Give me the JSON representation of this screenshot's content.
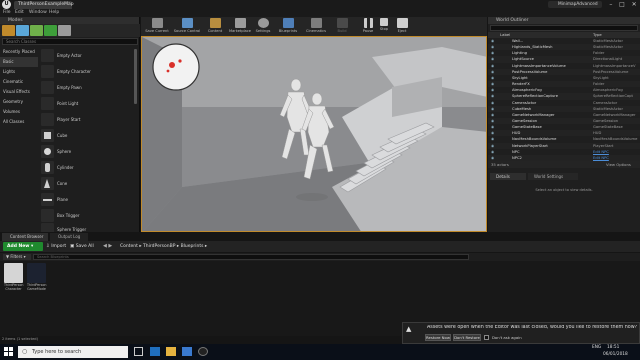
{
  "title_bar": {
    "doc_tab": "ThirdPersonExampleMap",
    "minimap_label": "MinimapAdvanced"
  },
  "menu": [
    "File",
    "Edit",
    "Window",
    "Help"
  ],
  "modes": {
    "header": "Modes",
    "search_placeholder": "Search Classes",
    "categories": [
      "Recently Placed",
      "Basic",
      "Lights",
      "Cinematic",
      "Visual Effects",
      "Geometry",
      "Volumes",
      "All Classes"
    ],
    "selected_category": "Basic",
    "items": [
      "Empty Actor",
      "Empty Character",
      "Empty Pawn",
      "Point Light",
      "Player Start",
      "Cube",
      "Sphere",
      "Cylinder",
      "Cone",
      "Plane",
      "Box Trigger",
      "Sphere Trigger"
    ]
  },
  "toolbar": {
    "buttons": [
      "Save Current",
      "Source Control",
      "Content",
      "Marketplace",
      "Settings",
      "Blueprints",
      "Cinematics",
      "Build",
      "Pause",
      "Stop",
      "Eject"
    ]
  },
  "world_outliner": {
    "header": "World Outliner",
    "col_label": "Label",
    "col_type": "Type",
    "rows": [
      {
        "name": "Wall...",
        "type": "StaticMeshActor"
      },
      {
        "name": "Highlands_StaticMesh",
        "type": "StaticMeshActor"
      },
      {
        "name": "Lighting",
        "type": "Folder"
      },
      {
        "name": "LightSource",
        "type": "DirectionalLight"
      },
      {
        "name": "LightmassImportanceVolume",
        "type": "LightmassImportanceV"
      },
      {
        "name": "PostProcessVolume",
        "type": "PostProcessVolume"
      },
      {
        "name": "SkyLight",
        "type": "SkyLight"
      },
      {
        "name": "RenderFX",
        "type": "Folder"
      },
      {
        "name": "AtmosphericFog",
        "type": "AtmosphericFog"
      },
      {
        "name": "SphereReflectionCapture",
        "type": "SphereReflectionCapt"
      },
      {
        "name": "CameraActor",
        "type": "CameraActor"
      },
      {
        "name": "CubeMesh",
        "type": "StaticMeshActor"
      },
      {
        "name": "GameNetworkManager",
        "type": "GameNetworkManager"
      },
      {
        "name": "GameSession",
        "type": "GameSession"
      },
      {
        "name": "GameStateBase",
        "type": "GameStateBase"
      },
      {
        "name": "HUD",
        "type": "HUD"
      },
      {
        "name": "NavMeshBoundsVolume",
        "type": "NavMeshBoundsVolume"
      },
      {
        "name": "NetworkPlayerStart",
        "type": "PlayerStart"
      },
      {
        "name": "NPC",
        "type": "Edit NPC",
        "link": true
      },
      {
        "name": "NPC2",
        "type": "Edit NPC",
        "link": true
      }
    ],
    "footer_count": "35 actors",
    "view_options": "View Options"
  },
  "details": {
    "tab_details": "Details",
    "tab_world": "World Settings",
    "empty_msg": "Select an object to view details."
  },
  "content_browser": {
    "tab_browser": "Content Browser",
    "tab_output": "Output Log",
    "add_new": "Add New",
    "import": "Import",
    "save_all": "Save All",
    "breadcrumb": [
      "Content",
      "ThirdPersonBP",
      "Blueprints"
    ],
    "filters": "Filters",
    "search_placeholder": "Search Blueprints",
    "assets": [
      {
        "name": "ThirdPerson Character",
        "color": "#d5d5d5"
      },
      {
        "name": "ThirdPerson GameMode",
        "color": "#1c2230"
      }
    ],
    "status": "2 items (1 selected)"
  },
  "notification": {
    "message": "Assets were open when the Editor was last closed, would you like to restore them now?",
    "restore_now": "Restore Now",
    "dont_restore": "Don't Restore",
    "dont_ask": "Don't ask again"
  },
  "taskbar": {
    "search_placeholder": "Type here to search",
    "time": "18:51",
    "date": "06/01/2018",
    "lang": "ENG"
  },
  "colors": {
    "accent_orange": "#c08a2b",
    "add_new_green": "#1f8a2e",
    "link_blue": "#4b8dd8"
  }
}
